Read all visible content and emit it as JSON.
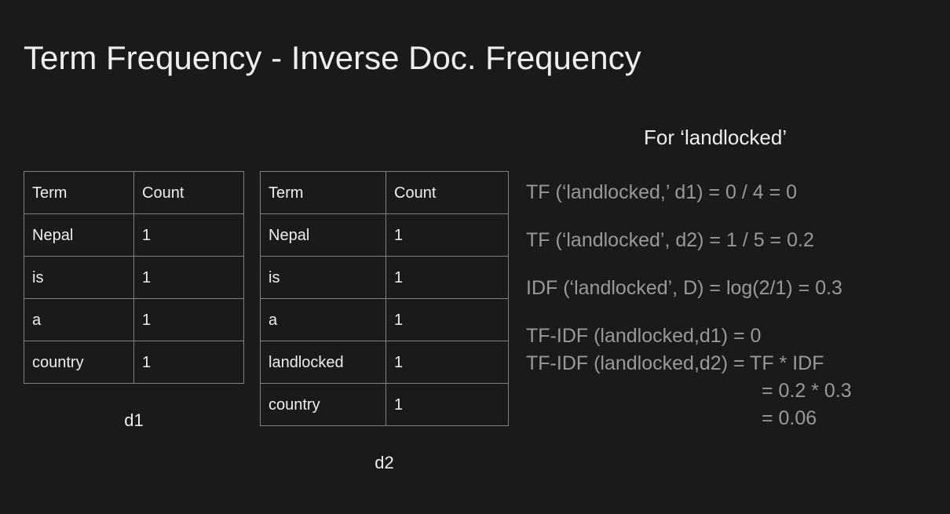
{
  "title": "Term Frequency - Inverse Doc. Frequency",
  "d1": {
    "caption": "d1",
    "headers": {
      "term": "Term",
      "count": "Count"
    },
    "rows": [
      {
        "term": "Nepal",
        "count": "1"
      },
      {
        "term": "is",
        "count": "1"
      },
      {
        "term": "a",
        "count": "1"
      },
      {
        "term": "country",
        "count": "1"
      }
    ]
  },
  "d2": {
    "caption": "d2",
    "headers": {
      "term": "Term",
      "count": "Count"
    },
    "rows": [
      {
        "term": "Nepal",
        "count": "1"
      },
      {
        "term": "is",
        "count": "1"
      },
      {
        "term": "a",
        "count": "1"
      },
      {
        "term": "landlocked",
        "count": "1"
      },
      {
        "term": "country",
        "count": "1"
      }
    ]
  },
  "calc": {
    "heading": "For ‘landlocked’",
    "l1": "TF (‘landlocked,’ d1)  =  0 / 4 = 0",
    "l2": "TF (‘landlocked’, d2) =   1 / 5 = 0.2",
    "l3": "IDF (‘landlocked’, D) = log(2/1) = 0.3",
    "l4": "TF-IDF (landlocked,d1) = 0",
    "l5": "TF-IDF (landlocked,d2) = TF * IDF",
    "l6": "= 0.2 * 0.3",
    "l7": "=  0.06"
  }
}
